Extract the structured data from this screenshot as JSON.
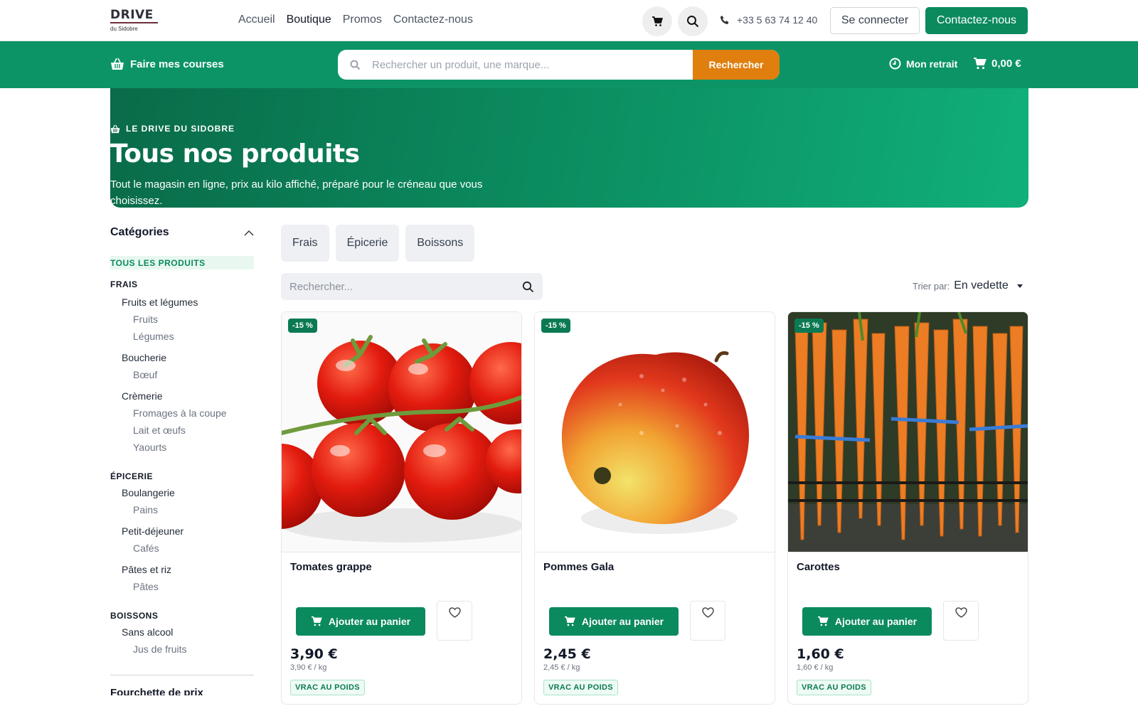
{
  "nav": {
    "brand_main": "DRIVE",
    "brand_sub": "du Sidobre",
    "links": [
      "Accueil",
      "Boutique",
      "Promos",
      "Contactez-nous"
    ],
    "phone": "+33 5 63 74 12 40",
    "login_label": "Se connecter",
    "contact_label": "Contactez-nous"
  },
  "bar": {
    "shop_label": "Faire mes courses",
    "search_placeholder": "Rechercher un produit, une marque...",
    "search_button": "Rechercher",
    "pickup_label": "Mon retrait",
    "cart_total": "0,00 €"
  },
  "hero": {
    "kicker": "LE DRIVE DU SIDOBRE",
    "title": "Tous nos produits",
    "subtitle": "Tout le magasin en ligne, prix au kilo affiché, préparé pour le créneau que vous choisissez."
  },
  "sidebar": {
    "title": "Catégories",
    "all_label": "TOUS LES PRODUITS",
    "groups": [
      {
        "title": "FRAIS",
        "subs": [
          {
            "name": "Fruits et légumes",
            "leaves": [
              "Fruits",
              "Légumes"
            ]
          },
          {
            "name": "Boucherie",
            "leaves": [
              "Bœuf"
            ]
          },
          {
            "name": "Crèmerie",
            "leaves": [
              "Fromages à la coupe",
              "Lait et œufs",
              "Yaourts"
            ]
          }
        ]
      },
      {
        "title": "ÉPICERIE",
        "subs": [
          {
            "name": "Boulangerie",
            "leaves": [
              "Pains"
            ]
          },
          {
            "name": "Petit-déjeuner",
            "leaves": [
              "Cafés"
            ]
          },
          {
            "name": "Pâtes et riz",
            "leaves": [
              "Pâtes"
            ]
          }
        ]
      },
      {
        "title": "BOISSONS",
        "subs": [
          {
            "name": "Sans alcool",
            "leaves": [
              "Jus de fruits"
            ]
          }
        ]
      }
    ],
    "cut_heading": "Fourchette de prix"
  },
  "filters": {
    "chips": [
      "Frais",
      "Épicerie",
      "Boissons"
    ],
    "search_placeholder": "Rechercher...",
    "sort_label": "Trier par:",
    "sort_value": "En vedette"
  },
  "products": [
    {
      "name": "Tomates grappe",
      "badge": "-15 %",
      "price": "3,90 €",
      "unit": "3,90 € / kg",
      "tag": "VRAC AU POIDS",
      "add_label": "Ajouter au panier"
    },
    {
      "name": "Pommes Gala",
      "badge": "-15 %",
      "price": "2,45 €",
      "unit": "2,45 € / kg",
      "tag": "VRAC AU POIDS",
      "add_label": "Ajouter au panier"
    },
    {
      "name": "Carottes",
      "badge": "-15 %",
      "price": "1,60 €",
      "unit": "1,60 € / kg",
      "tag": "VRAC AU POIDS",
      "add_label": "Ajouter au panier"
    }
  ],
  "colors": {
    "brand_green": "#0b8a5e",
    "accent_orange": "#e07f0e"
  },
  "icons": [
    "cart-icon",
    "search-icon",
    "phone-icon",
    "basket-icon",
    "clock-icon",
    "chevron-up-icon",
    "heart-icon"
  ]
}
